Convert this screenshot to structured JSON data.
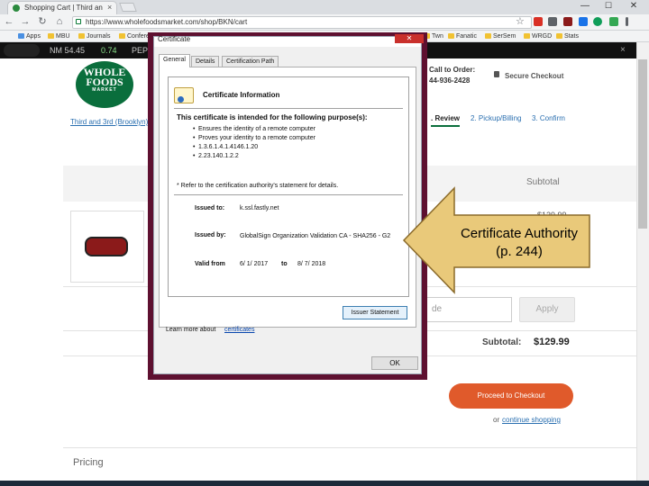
{
  "browser": {
    "tab_title": "Shopping Cart | Third an",
    "tab_close": "×",
    "url": "https://www.wholefoodsmarket.com/shop/BKN/cart",
    "window_min": "—",
    "window_max": "☐",
    "window_close": "✕",
    "nav_back": "←",
    "nav_forward": "→",
    "nav_reload": "↻",
    "nav_home": "⌂",
    "star": "☆",
    "bookmarks": [
      "Apps",
      "MBU",
      "Journals",
      "Conferences",
      "Twn",
      "Fanatic",
      "SerSem",
      "WRGD",
      "Stats"
    ]
  },
  "page": {
    "ticker": [
      "NM 54.45",
      "0.74",
      "PEP"
    ],
    "ticker_close": "×",
    "logo_line1": "WHOLE",
    "logo_line2": "FOODS",
    "logo_line3": "MARKET",
    "store_link": "Third and 3rd (Brooklyn)",
    "call_label": "Call to Order:",
    "call_number": "44-936-2428",
    "secure_checkout": "Secure Checkout",
    "steps": {
      "review": ". Review",
      "pickup": "2. Pickup/Billing",
      "confirm": "3. Confirm"
    },
    "subtotal_heading": "Subtotal",
    "price_partial": "$129.99",
    "promo_placeholder": "de",
    "apply_label": "Apply",
    "subtotal_label": "Subtotal:",
    "subtotal_value": "$129.99",
    "checkout_label": "Proceed to Checkout",
    "or_text": "or",
    "continue_label": "continue shopping",
    "pricing_heading": "Pricing"
  },
  "dialog": {
    "title": "Certificate",
    "close": "✕",
    "tabs": [
      "General",
      "Details",
      "Certification Path"
    ],
    "info_title": "Certificate Information",
    "purpose_heading": "This certificate is intended for the following purpose(s):",
    "purposes": [
      "Ensures the identity of a remote computer",
      "Proves your identity to a remote computer",
      "1.3.6.1.4.1.4146.1.20",
      "2.23.140.1.2.2"
    ],
    "footnote": "* Refer to the certification authority's statement for details.",
    "issued_to_label": "Issued to:",
    "issued_to_value": "k.ssl.fastly.net",
    "issued_by_label": "Issued by:",
    "issued_by_value": "GlobalSign Organization Validation CA - SHA256 - G2",
    "valid_from_label": "Valid from",
    "valid_from_value": "6/ 1/ 2017",
    "valid_to_label": "to",
    "valid_to_value": "8/ 7/ 2018",
    "issuer_button": "Issuer Statement",
    "learn_more_text": "Learn more about",
    "learn_more_link": "certificates",
    "ok_button": "OK"
  },
  "callout": {
    "line1": "Certificate Authority",
    "line2": "(p. 244)"
  },
  "colors": {
    "dialog_frame": "#5e1030",
    "callout_fill": "#e9c97a",
    "checkout_button": "#e05a2b",
    "brand_green": "#0a6e3c"
  }
}
